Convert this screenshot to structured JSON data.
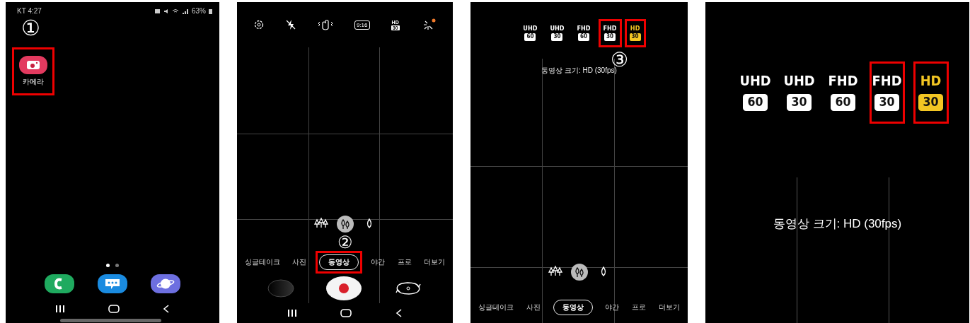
{
  "panels": [
    {
      "kind": "home",
      "status_bar": {
        "left": "KT 4:27",
        "battery": "63%"
      },
      "step_marker": "①",
      "apps": [
        {
          "label": "카메라",
          "highlighted": true
        }
      ],
      "page_dots": [
        {
          "selected": true
        },
        {
          "selected": false
        }
      ],
      "dock": [
        {
          "kind": "phone"
        },
        {
          "kind": "messages"
        },
        {
          "kind": "browser"
        }
      ]
    },
    {
      "kind": "camera",
      "toolbar": [
        {
          "kind": "settings"
        },
        {
          "kind": "flash_off"
        },
        {
          "kind": "hand"
        },
        {
          "kind": "ratio",
          "label": "9:16"
        },
        {
          "kind": "resolution",
          "label": "HD",
          "badge": "30"
        },
        {
          "kind": "effects",
          "notification": true
        }
      ],
      "step_marker": "②",
      "zoom_options": [
        {
          "kind": "wide",
          "selected": false
        },
        {
          "kind": "normal",
          "selected": true
        },
        {
          "kind": "tele",
          "selected": false
        }
      ],
      "modes": [
        {
          "label": "싱글테이크",
          "selected": false,
          "highlighted": false
        },
        {
          "label": "사진",
          "selected": false,
          "highlighted": false
        },
        {
          "label": "동영상",
          "selected": true,
          "highlighted": true
        },
        {
          "label": "야간",
          "selected": false,
          "highlighted": false
        },
        {
          "label": "프로",
          "selected": false,
          "highlighted": false
        },
        {
          "label": "더보기",
          "selected": false,
          "highlighted": false
        }
      ],
      "shutter": {
        "recording": true
      }
    },
    {
      "kind": "camera",
      "resolution_options": [
        {
          "label": "UHD",
          "badge": "60",
          "selected": false,
          "highlighted": false
        },
        {
          "label": "UHD",
          "badge": "30",
          "selected": false,
          "highlighted": false
        },
        {
          "label": "FHD",
          "badge": "60",
          "selected": false,
          "highlighted": false
        },
        {
          "label": "FHD",
          "badge": "30",
          "selected": false,
          "highlighted": true
        },
        {
          "label": "HD",
          "badge": "30",
          "selected": true,
          "highlighted": true
        }
      ],
      "step_marker": "③",
      "caption": "동영상 크기: HD (30fps)",
      "zoom_options": [
        {
          "kind": "wide",
          "selected": false
        },
        {
          "kind": "normal",
          "selected": true
        },
        {
          "kind": "tele",
          "selected": false
        }
      ],
      "modes": [
        {
          "label": "싱글테이크",
          "selected": false,
          "highlighted": false
        },
        {
          "label": "사진",
          "selected": false,
          "highlighted": false
        },
        {
          "label": "동영상",
          "selected": true,
          "highlighted": false
        },
        {
          "label": "야간",
          "selected": false,
          "highlighted": false
        },
        {
          "label": "프로",
          "selected": false,
          "highlighted": false
        },
        {
          "label": "더보기",
          "selected": false,
          "highlighted": false
        }
      ]
    },
    {
      "kind": "zoom",
      "resolution_options": [
        {
          "label": "UHD",
          "badge": "60",
          "selected": false,
          "highlighted": false
        },
        {
          "label": "UHD",
          "badge": "30",
          "selected": false,
          "highlighted": false
        },
        {
          "label": "FHD",
          "badge": "60",
          "selected": false,
          "highlighted": false
        },
        {
          "label": "FHD",
          "badge": "30",
          "selected": false,
          "highlighted": true
        },
        {
          "label": "HD",
          "badge": "30",
          "selected": true,
          "highlighted": true
        }
      ],
      "caption": "동영상 크기: HD (30fps)"
    }
  ]
}
